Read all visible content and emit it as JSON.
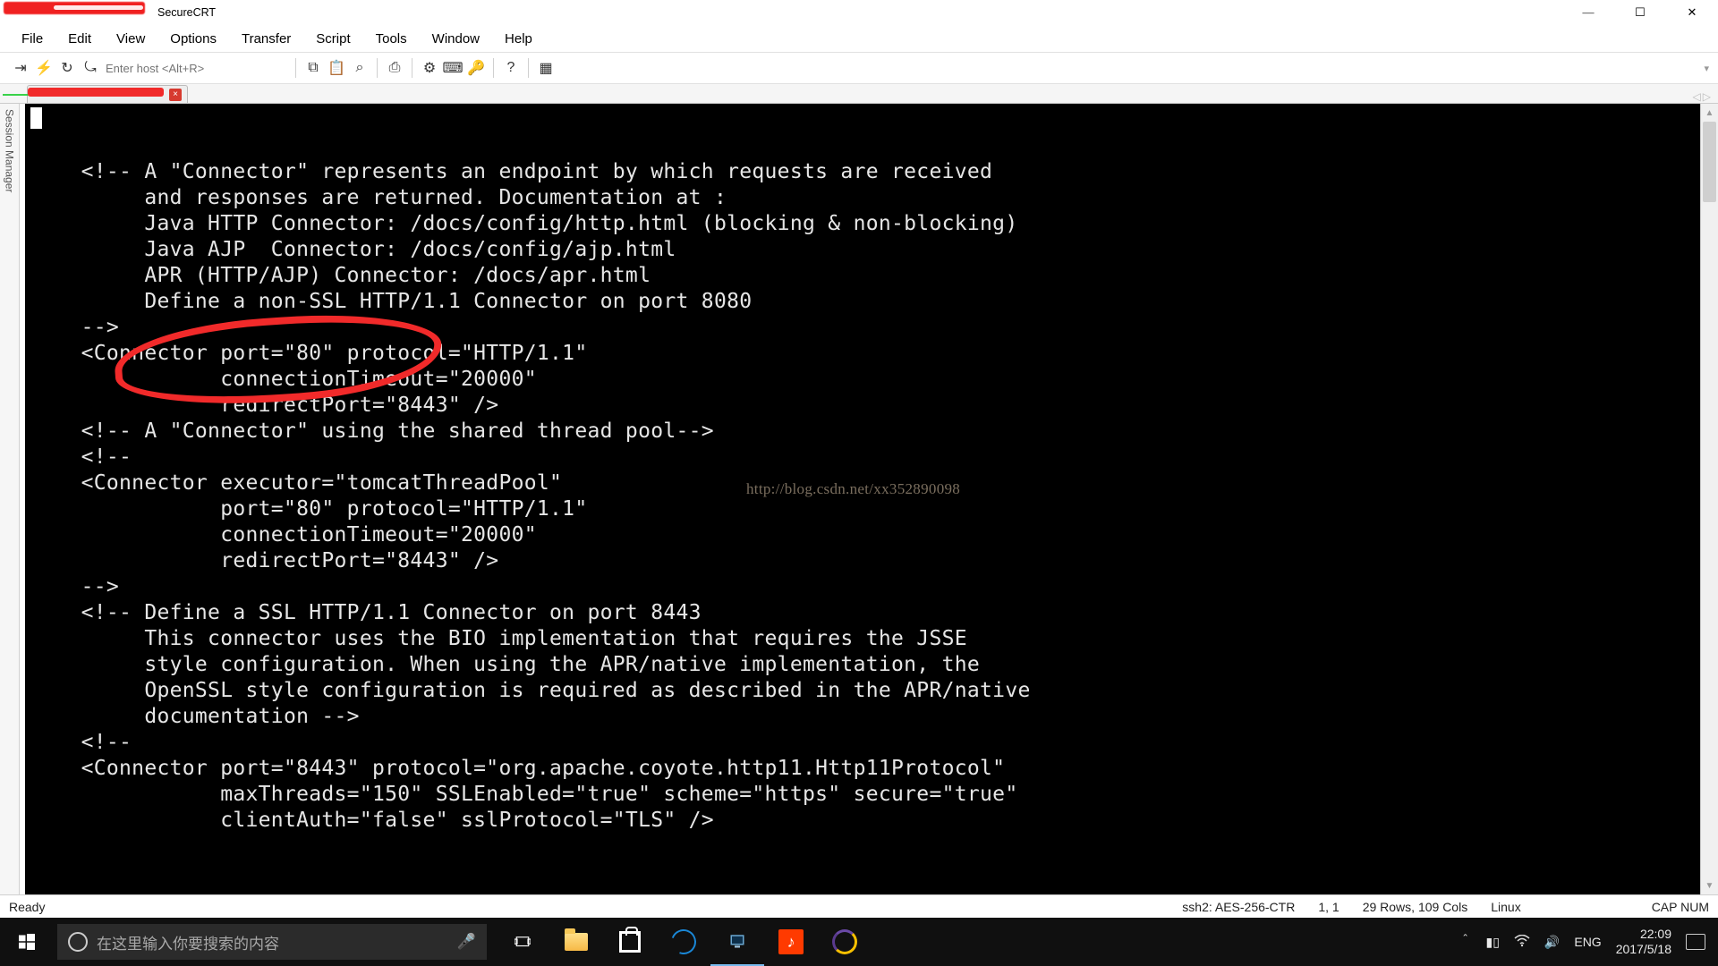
{
  "title": {
    "app_name": "SecureCRT"
  },
  "window_controls": {
    "min": "—",
    "max": "☐",
    "close": "✕"
  },
  "menu": {
    "file": "File",
    "edit": "Edit",
    "view": "View",
    "options": "Options",
    "transfer": "Transfer",
    "script": "Script",
    "tools": "Tools",
    "window": "Window",
    "help": "Help"
  },
  "toolbar": {
    "host_placeholder": "Enter host <Alt+R>",
    "icons": {
      "connect": "⇥",
      "quick": "⚡",
      "reconnect": "↻",
      "disconnect": "⤿",
      "copy": "⧉",
      "paste": "📋",
      "find": "⌕",
      "print": "⎙",
      "settings": "⚙",
      "keyboard": "⌨",
      "keymap": "🔑",
      "help": "?",
      "command": "▦"
    }
  },
  "tabs": {
    "close_tooltip": "Close"
  },
  "sidepanel": {
    "label": "Session Manager"
  },
  "terminal": {
    "watermark": "http://blog.csdn.net/xx352890098",
    "lines": [
      "",
      "",
      "    <!-- A \"Connector\" represents an endpoint by which requests are received",
      "         and responses are returned. Documentation at :",
      "         Java HTTP Connector: /docs/config/http.html (blocking & non-blocking)",
      "         Java AJP  Connector: /docs/config/ajp.html",
      "         APR (HTTP/AJP) Connector: /docs/apr.html",
      "         Define a non-SSL HTTP/1.1 Connector on port 8080",
      "    -->",
      "    <Connector port=\"80\" protocol=\"HTTP/1.1\"",
      "               connectionTimeout=\"20000\"",
      "               redirectPort=\"8443\" />",
      "    <!-- A \"Connector\" using the shared thread pool-->",
      "    <!--",
      "    <Connector executor=\"tomcatThreadPool\"",
      "               port=\"80\" protocol=\"HTTP/1.1\"",
      "               connectionTimeout=\"20000\"",
      "               redirectPort=\"8443\" />",
      "    -->",
      "    <!-- Define a SSL HTTP/1.1 Connector on port 8443",
      "         This connector uses the BIO implementation that requires the JSSE",
      "         style configuration. When using the APR/native implementation, the",
      "         OpenSSL style configuration is required as described in the APR/native",
      "         documentation -->",
      "    <!--",
      "    <Connector port=\"8443\" protocol=\"org.apache.coyote.http11.Http11Protocol\"",
      "               maxThreads=\"150\" SSLEnabled=\"true\" scheme=\"https\" secure=\"true\"",
      "               clientAuth=\"false\" sslProtocol=\"TLS\" />"
    ]
  },
  "status": {
    "ready": "Ready",
    "protocol": "ssh2: AES-256-CTR",
    "cursor": "1,  1",
    "dims": "29 Rows, 109 Cols",
    "emul": "Linux",
    "capnum": "CAP NUM"
  },
  "taskbar": {
    "search_placeholder": "在这里输入你要搜索的内容",
    "lang": "ENG",
    "time": "22:09",
    "date": "2017/5/18"
  }
}
